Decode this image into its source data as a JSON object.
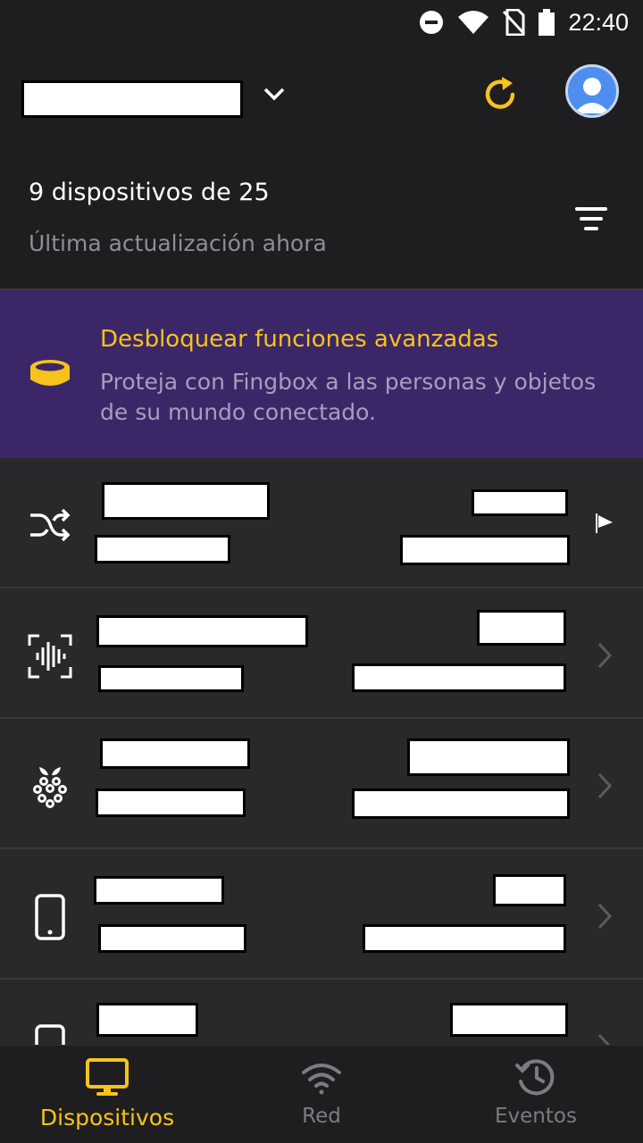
{
  "status_bar": {
    "time": "22:40"
  },
  "summary": {
    "count_text": "9 dispositivos de 25",
    "updated_text": "Última actualización ahora"
  },
  "promo": {
    "title": "Desbloquear funciones avanzadas",
    "body": "Proteja con Fingbox a las personas y objetos de su mundo conectado."
  },
  "devices": [
    {
      "icon": "shuffle-icon",
      "trailing": "flag-icon"
    },
    {
      "icon": "voice-assistant-icon",
      "trailing": "chevron-right-icon"
    },
    {
      "icon": "raspberry-pi-icon",
      "trailing": "chevron-right-icon"
    },
    {
      "icon": "smartphone-icon",
      "trailing": "chevron-right-icon"
    },
    {
      "icon": "smartphone-icon",
      "trailing": "chevron-right-icon"
    }
  ],
  "bottom_nav": {
    "items": [
      {
        "label": "Dispositivos",
        "icon": "monitor-icon",
        "active": true
      },
      {
        "label": "Red",
        "icon": "wifi-icon",
        "active": false
      },
      {
        "label": "Eventos",
        "icon": "history-icon",
        "active": false
      }
    ]
  },
  "colors": {
    "accent": "#f7c31b",
    "background": "#1e1e20",
    "promo_background": "#3b2768",
    "list_background": "#29292b",
    "muted_text": "#8e8e93"
  }
}
